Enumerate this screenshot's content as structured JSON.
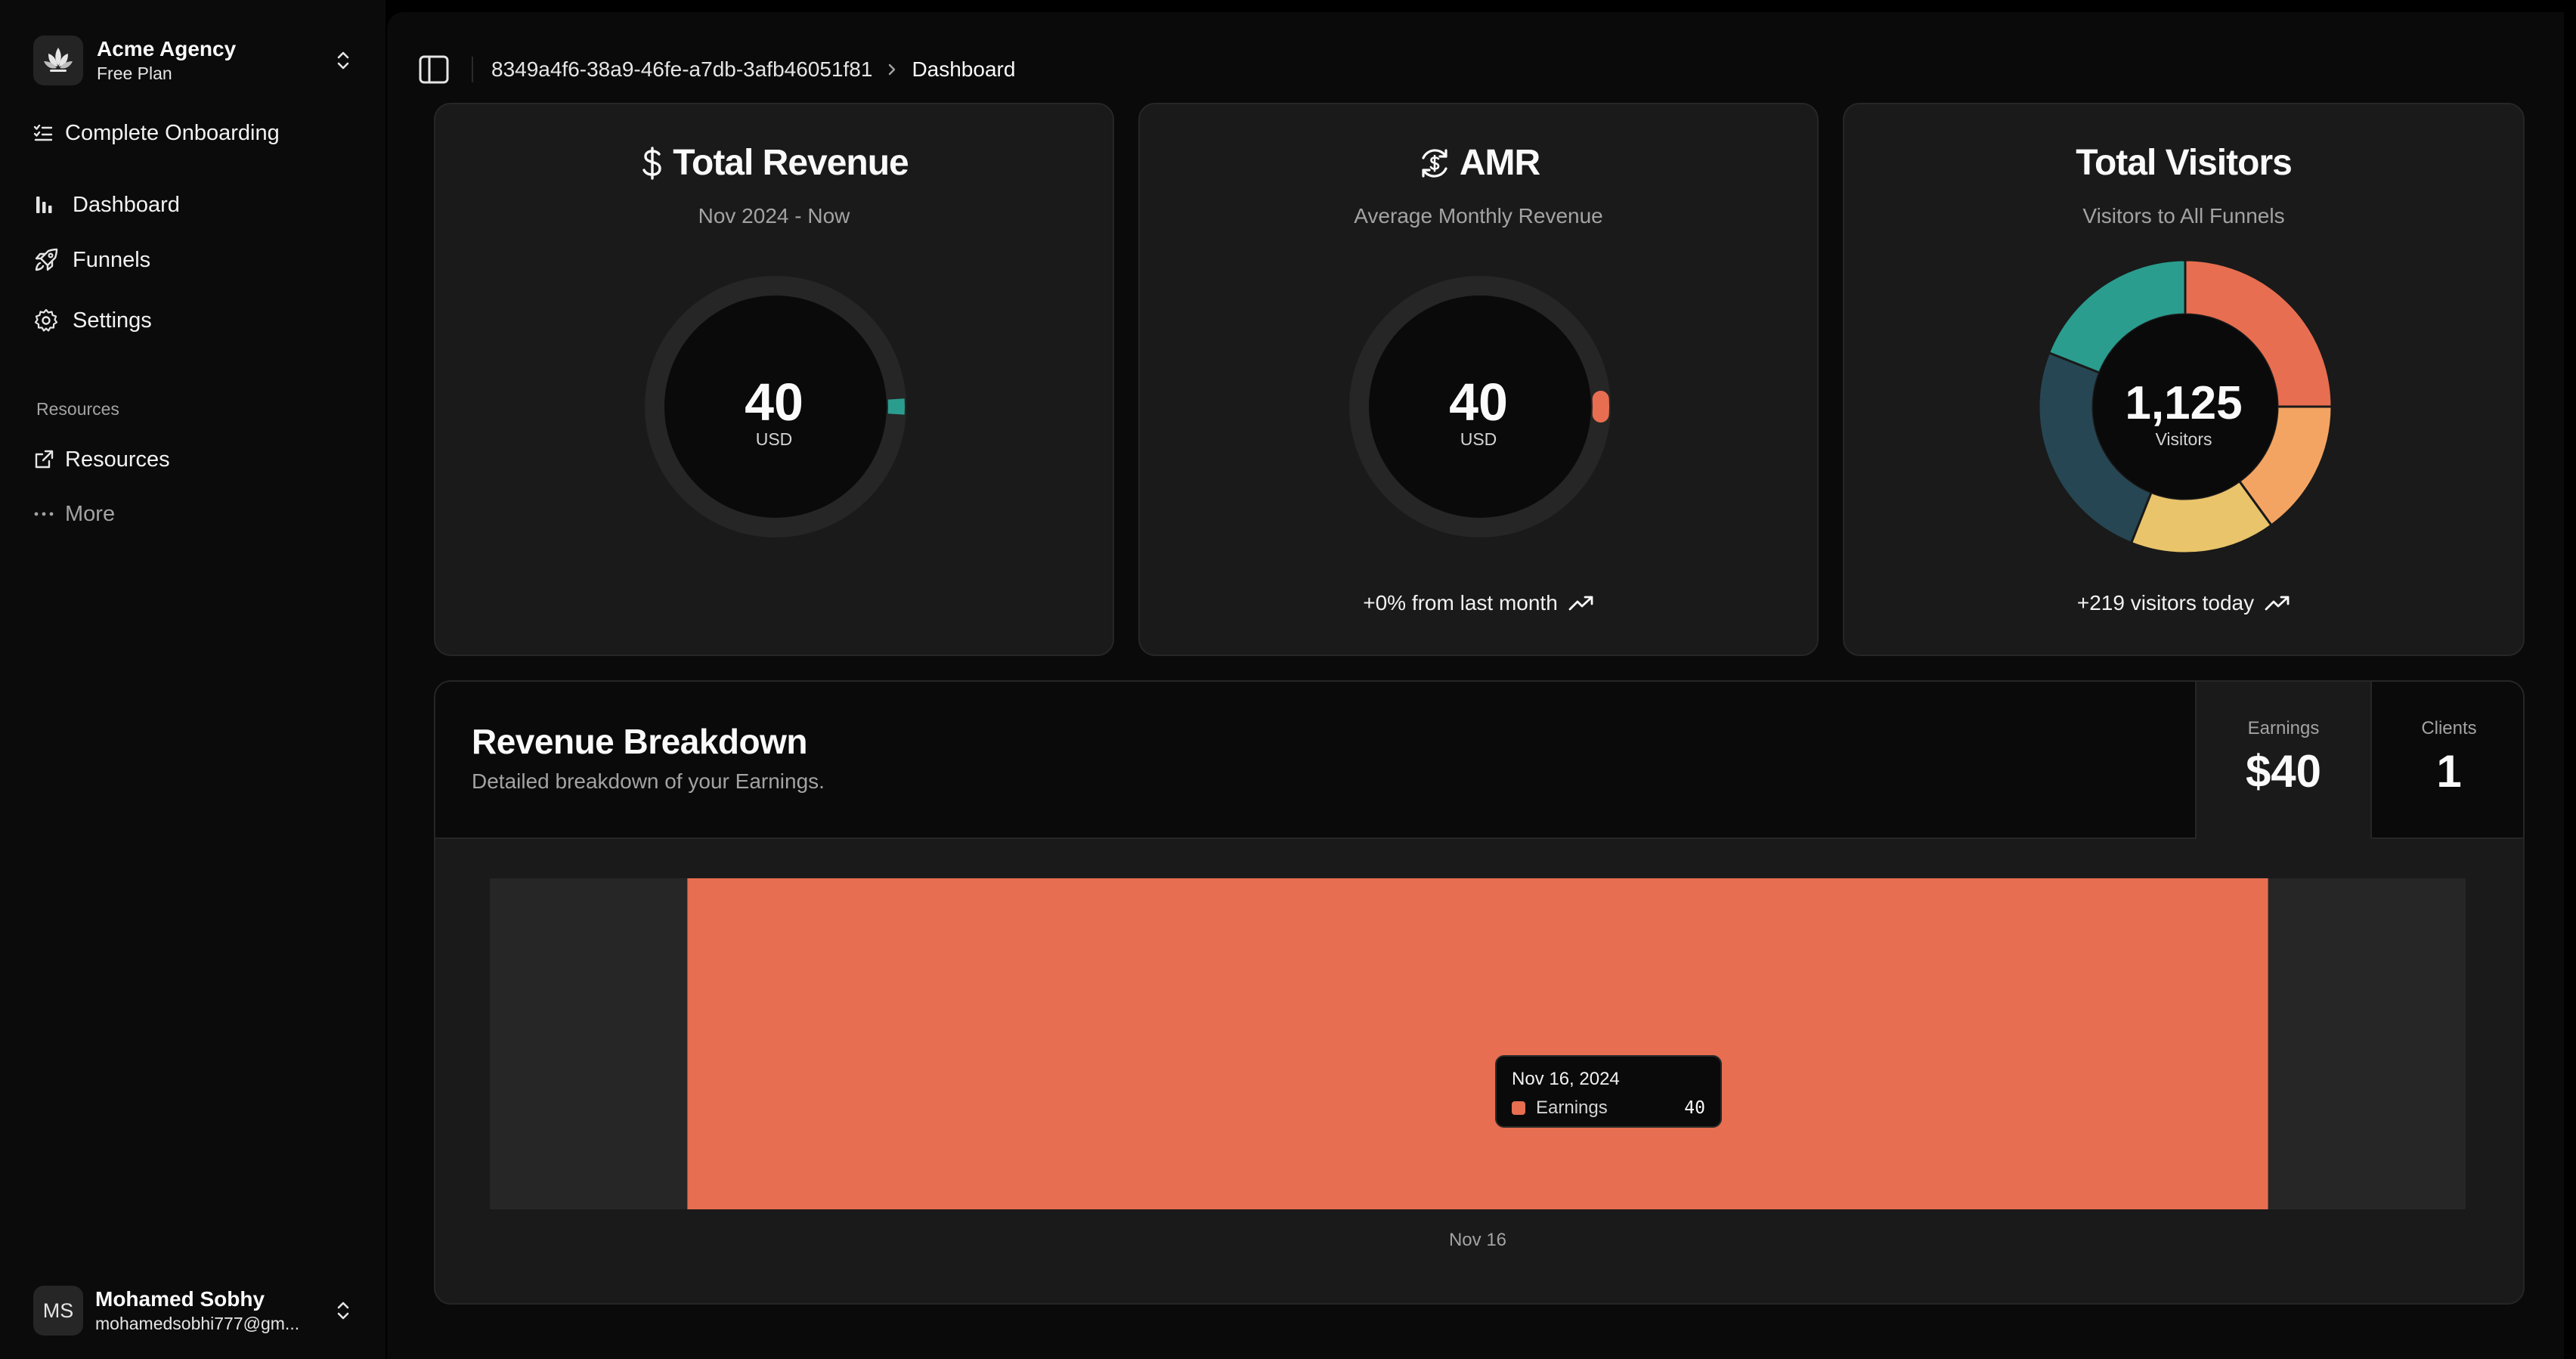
{
  "sidebar": {
    "team": {
      "name": "Acme Agency",
      "plan": "Free Plan"
    },
    "onboarding": "Complete Onboarding",
    "items": [
      {
        "label": "Dashboard",
        "icon": "bar-chart-icon"
      },
      {
        "label": "Funnels",
        "icon": "rocket-icon"
      },
      {
        "label": "Settings",
        "icon": "gear-icon"
      }
    ],
    "group_label": "Resources",
    "resources": [
      {
        "label": "Resources",
        "icon": "external-link-icon"
      },
      {
        "label": "More",
        "icon": "more-dots-icon"
      }
    ],
    "user": {
      "initials": "MS",
      "name": "Mohamed Sobhy",
      "email": "mohamedsobhi777@gm..."
    }
  },
  "breadcrumb": {
    "project": "8349a4f6-38a9-46fe-a7db-3afb46051f81",
    "page": "Dashboard"
  },
  "cards": {
    "revenue": {
      "title": "Total Revenue",
      "subtitle": "Nov 2024 - Now",
      "value": "40",
      "unit": "USD",
      "gauge_fraction": 0.02
    },
    "amr": {
      "title": "AMR",
      "subtitle": "Average Monthly Revenue",
      "value": "40",
      "unit": "USD",
      "gauge_fraction": 0.02,
      "footer": "+0% from last month"
    },
    "visitors": {
      "title": "Total Visitors",
      "subtitle": "Visitors to All Funnels",
      "value": "1,125",
      "unit": "Visitors",
      "footer": "+219 visitors today"
    }
  },
  "colors": {
    "accent_teal": "#2a9d8f",
    "accent_coral": "#e76e50",
    "donut": [
      "#e76e50",
      "#f4a462",
      "#e9c46a",
      "#264653",
      "#2a9d8f"
    ]
  },
  "breakdown": {
    "title": "Revenue Breakdown",
    "subtitle": "Detailed breakdown of your Earnings.",
    "stats": [
      {
        "label": "Earnings",
        "value": "$40"
      },
      {
        "label": "Clients",
        "value": "1"
      }
    ],
    "tooltip": {
      "date": "Nov 16, 2024",
      "series": "Earnings",
      "value": "40"
    }
  },
  "chart_data": [
    {
      "type": "pie",
      "categories": [
        "segment-1",
        "segment-2",
        "segment-3",
        "segment-4",
        "segment-5"
      ],
      "values": [
        25,
        15,
        16,
        25,
        19
      ]
    },
    {
      "type": "bar",
      "categories": [
        "Nov 16"
      ],
      "series": [
        {
          "name": "Earnings",
          "values": [
            40
          ]
        }
      ],
      "ylim": [
        0,
        40
      ]
    }
  ]
}
